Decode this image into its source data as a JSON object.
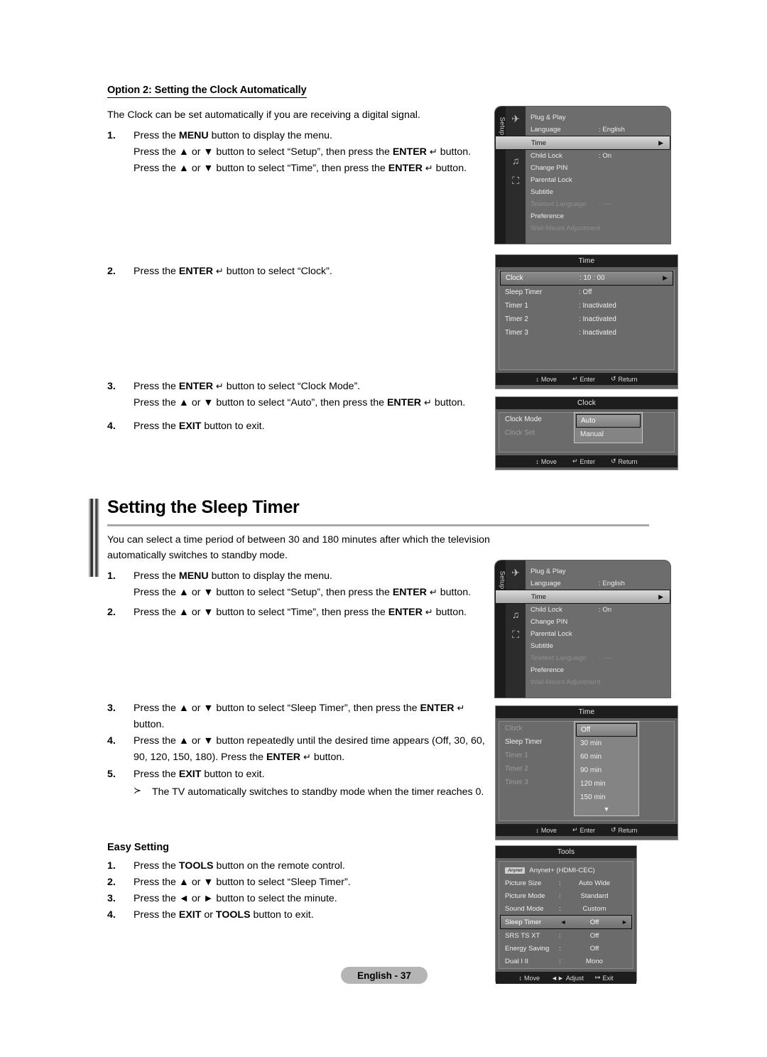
{
  "document": {
    "page_footer": "English - 37"
  },
  "option2": {
    "heading": "Option 2: Setting the Clock Automatically",
    "intro": "The Clock can be set automatically if you are receiving a digital signal.",
    "steps": [
      {
        "num": "1.",
        "lines": [
          "Press the MENU button to display the menu.",
          "Press the ▲ or ▼ button to select “Setup”, then press the ENTER ↵ button.",
          "Press the ▲ or ▼ button to select “Time”, then press the ENTER ↵ button."
        ]
      },
      {
        "num": "2.",
        "lines": [
          "Press the ENTER ↵ button to select “Clock”."
        ]
      },
      {
        "num": "3.",
        "lines": [
          "Press the ENTER ↵ button to select “Clock Mode”.",
          "Press the ▲ or ▼ button to select “Auto”, then press the ENTER ↵ button."
        ]
      },
      {
        "num": "4.",
        "lines": [
          "Press the EXIT button to exit."
        ]
      }
    ]
  },
  "sleep_timer_section": {
    "title": "Setting the Sleep Timer",
    "intro": "You can select a time period of between 30 and 180 minutes after which the television automatically switches to standby mode.",
    "steps": [
      {
        "num": "1.",
        "lines": [
          "Press the MENU button to display the menu.",
          "Press the ▲ or ▼ button to select “Setup”, then press the ENTER ↵ button."
        ]
      },
      {
        "num": "2.",
        "lines": [
          "Press the ▲ or ▼ button to select “Time”, then press the ENTER ↵ button."
        ]
      },
      {
        "num": "3.",
        "lines": [
          "Press the ▲ or ▼ button to select “Sleep Timer”, then press the ENTER ↵ button."
        ]
      },
      {
        "num": "4.",
        "lines": [
          "Press the ▲ or ▼ button repeatedly until the desired time appears (Off, 30, 60, 90, 120, 150, 180). Press the ENTER ↵ button."
        ]
      },
      {
        "num": "5.",
        "lines": [
          "Press the EXIT button to exit."
        ]
      }
    ],
    "note": "The TV automatically switches to standby mode when the timer reaches 0.",
    "note_glyph": "≻"
  },
  "easy_setting": {
    "heading": "Easy Setting",
    "steps": [
      {
        "num": "1.",
        "text": "Press the TOOLS button on the remote control."
      },
      {
        "num": "2.",
        "text": "Press the ▲ or ▼ button to select “Sleep Timer”."
      },
      {
        "num": "3.",
        "text": "Press the ◄ or ► button to select the minute."
      },
      {
        "num": "4.",
        "text": "Press the EXIT or TOOLS button to exit."
      }
    ]
  },
  "osd": {
    "setup_menu": {
      "tab_label": "Setup",
      "icons": [
        "picture-icon",
        "setup-gear-icon",
        "sound-icon",
        "input-icon"
      ],
      "rows": [
        {
          "label": "Plug & Play",
          "value": "",
          "state": "normal"
        },
        {
          "label": "Language",
          "value": ": English",
          "state": "normal"
        },
        {
          "label": "Time",
          "value": "",
          "state": "selected",
          "arrow": "▶"
        },
        {
          "label": "Child Lock",
          "value": ": On",
          "state": "normal"
        },
        {
          "label": "Change PIN",
          "value": "",
          "state": "normal"
        },
        {
          "label": "Parental Lock",
          "value": "",
          "state": "normal"
        },
        {
          "label": "Subtitle",
          "value": "",
          "state": "normal"
        },
        {
          "label": "Teletext Language",
          "value": ": ----",
          "state": "dim"
        },
        {
          "label": "Preference",
          "value": "",
          "state": "normal"
        },
        {
          "label": "Wall-Mount Adjustment",
          "value": "",
          "state": "dim"
        }
      ]
    },
    "time_menu": {
      "title": "Time",
      "rows": [
        {
          "label": "Clock",
          "value": ": 10 : 00",
          "state": "highlighted",
          "arrow": "▶"
        },
        {
          "label": "Sleep Timer",
          "value": ": Off",
          "state": "normal"
        },
        {
          "label": "Timer 1",
          "value": ": Inactivated",
          "state": "normal"
        },
        {
          "label": "Timer 2",
          "value": ": Inactivated",
          "state": "normal"
        },
        {
          "label": "Timer 3",
          "value": ": Inactivated",
          "state": "normal"
        }
      ],
      "footer": [
        {
          "icon": "↕",
          "label": "Move"
        },
        {
          "icon": "↵",
          "label": "Enter"
        },
        {
          "icon": "↺",
          "label": "Return"
        }
      ]
    },
    "clock_menu": {
      "title": "Clock",
      "rows": [
        {
          "label": "Clock Mode",
          "value": ":",
          "state": "normal"
        },
        {
          "label": "Clock Set",
          "value": "",
          "state": "dim"
        }
      ],
      "dropdown": [
        {
          "label": "Auto",
          "selected": true
        },
        {
          "label": "Manual",
          "selected": false
        }
      ],
      "footer": [
        {
          "icon": "↕",
          "label": "Move"
        },
        {
          "icon": "↵",
          "label": "Enter"
        },
        {
          "icon": "↺",
          "label": "Return"
        }
      ]
    },
    "time_menu_sleep": {
      "title": "Time",
      "rows": [
        {
          "label": "Clock",
          "value": ":",
          "state": "dim"
        },
        {
          "label": "Sleep Timer",
          "value": ":",
          "state": "normal"
        },
        {
          "label": "Timer 1",
          "value": ":",
          "state": "dim"
        },
        {
          "label": "Timer 2",
          "value": ":",
          "state": "dim"
        },
        {
          "label": "Timer 3",
          "value": ":",
          "state": "dim"
        }
      ],
      "dropdown": [
        {
          "label": "Off",
          "selected": true
        },
        {
          "label": "30 min",
          "selected": false
        },
        {
          "label": "60 min",
          "selected": false
        },
        {
          "label": "90 min",
          "selected": false
        },
        {
          "label": "120 min",
          "selected": false
        },
        {
          "label": "150 min",
          "selected": false
        },
        {
          "label": "▼",
          "selected": false,
          "more": true
        }
      ],
      "footer": [
        {
          "icon": "↕",
          "label": "Move"
        },
        {
          "icon": "↵",
          "label": "Enter"
        },
        {
          "icon": "↺",
          "label": "Return"
        }
      ]
    },
    "tools_menu": {
      "title": "Tools",
      "badge": "Anynet",
      "rows": [
        {
          "label": "Anynet+ (HDMI-CEC)",
          "colon": "",
          "value": "",
          "state": "badge"
        },
        {
          "label": "Picture Size",
          "colon": ":",
          "value": "Auto Wide",
          "state": "normal"
        },
        {
          "label": "Picture Mode",
          "colon": ":",
          "value": "Standard",
          "state": "normal"
        },
        {
          "label": "Sound Mode",
          "colon": ":",
          "value": "Custom",
          "state": "normal"
        },
        {
          "label": "Sleep Timer",
          "colon": "◄",
          "value": "Off",
          "state": "highlighted",
          "arrow": "►"
        },
        {
          "label": "SRS TS XT",
          "colon": ":",
          "value": "Off",
          "state": "normal"
        },
        {
          "label": "Energy Saving",
          "colon": ":",
          "value": "Off",
          "state": "normal"
        },
        {
          "label": "Dual I II",
          "colon": ":",
          "value": "Mono",
          "state": "normal"
        }
      ],
      "footer": [
        {
          "icon": "↕",
          "label": "Move"
        },
        {
          "icon": "◄►",
          "label": "Adjust"
        },
        {
          "icon": "↦",
          "label": "Exit"
        }
      ]
    }
  }
}
